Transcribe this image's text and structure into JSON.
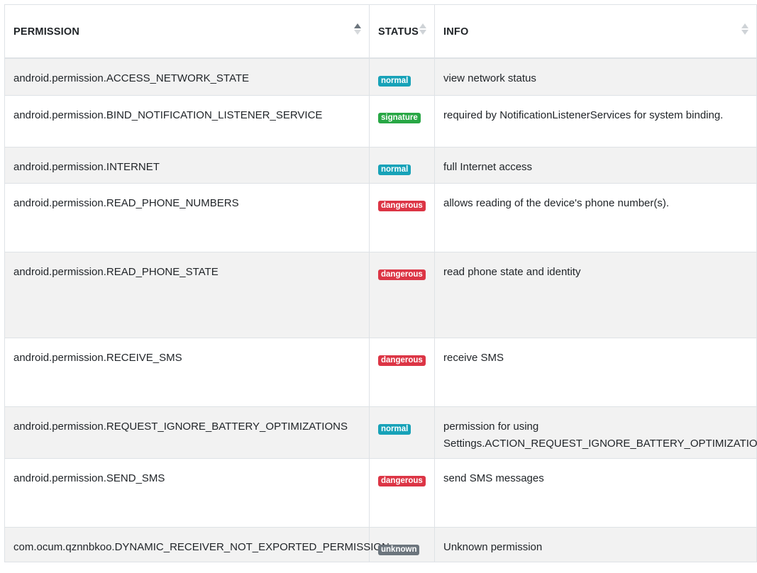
{
  "table": {
    "columns": [
      {
        "label": "PERMISSION",
        "sort": "ascending"
      },
      {
        "label": "STATUS",
        "sort": "none"
      },
      {
        "label": "INFO",
        "sort": "none"
      }
    ],
    "rows": [
      {
        "permission": "android.permission.ACCESS_NETWORK_STATE",
        "status": "normal",
        "info": "view network status"
      },
      {
        "permission": "android.permission.BIND_NOTIFICATION_LISTENER_SERVICE",
        "status": "signature",
        "info": "required by NotificationListenerServices for system binding."
      },
      {
        "permission": "android.permission.INTERNET",
        "status": "normal",
        "info": "full Internet access"
      },
      {
        "permission": "android.permission.READ_PHONE_NUMBERS",
        "status": "dangerous",
        "info": "allows reading of the device's phone number(s)."
      },
      {
        "permission": "android.permission.READ_PHONE_STATE",
        "status": "dangerous",
        "info": "read phone state and identity"
      },
      {
        "permission": "android.permission.RECEIVE_SMS",
        "status": "dangerous",
        "info": "receive SMS"
      },
      {
        "permission": "android.permission.REQUEST_IGNORE_BATTERY_OPTIMIZATIONS",
        "status": "normal",
        "info": "permission for using Settings.ACTION_REQUEST_IGNORE_BATTERY_OPTIMIZATIONS."
      },
      {
        "permission": "android.permission.SEND_SMS",
        "status": "dangerous",
        "info": "send SMS messages"
      },
      {
        "permission": "com.ocum.qznnbkoo.DYNAMIC_RECEIVER_NOT_EXPORTED_PERMISSION",
        "status": "unknown",
        "info": "Unknown permission"
      }
    ]
  },
  "status_colors": {
    "normal": "#17a2b8",
    "signature": "#28a745",
    "dangerous": "#dc3545",
    "unknown": "#6c757d"
  }
}
